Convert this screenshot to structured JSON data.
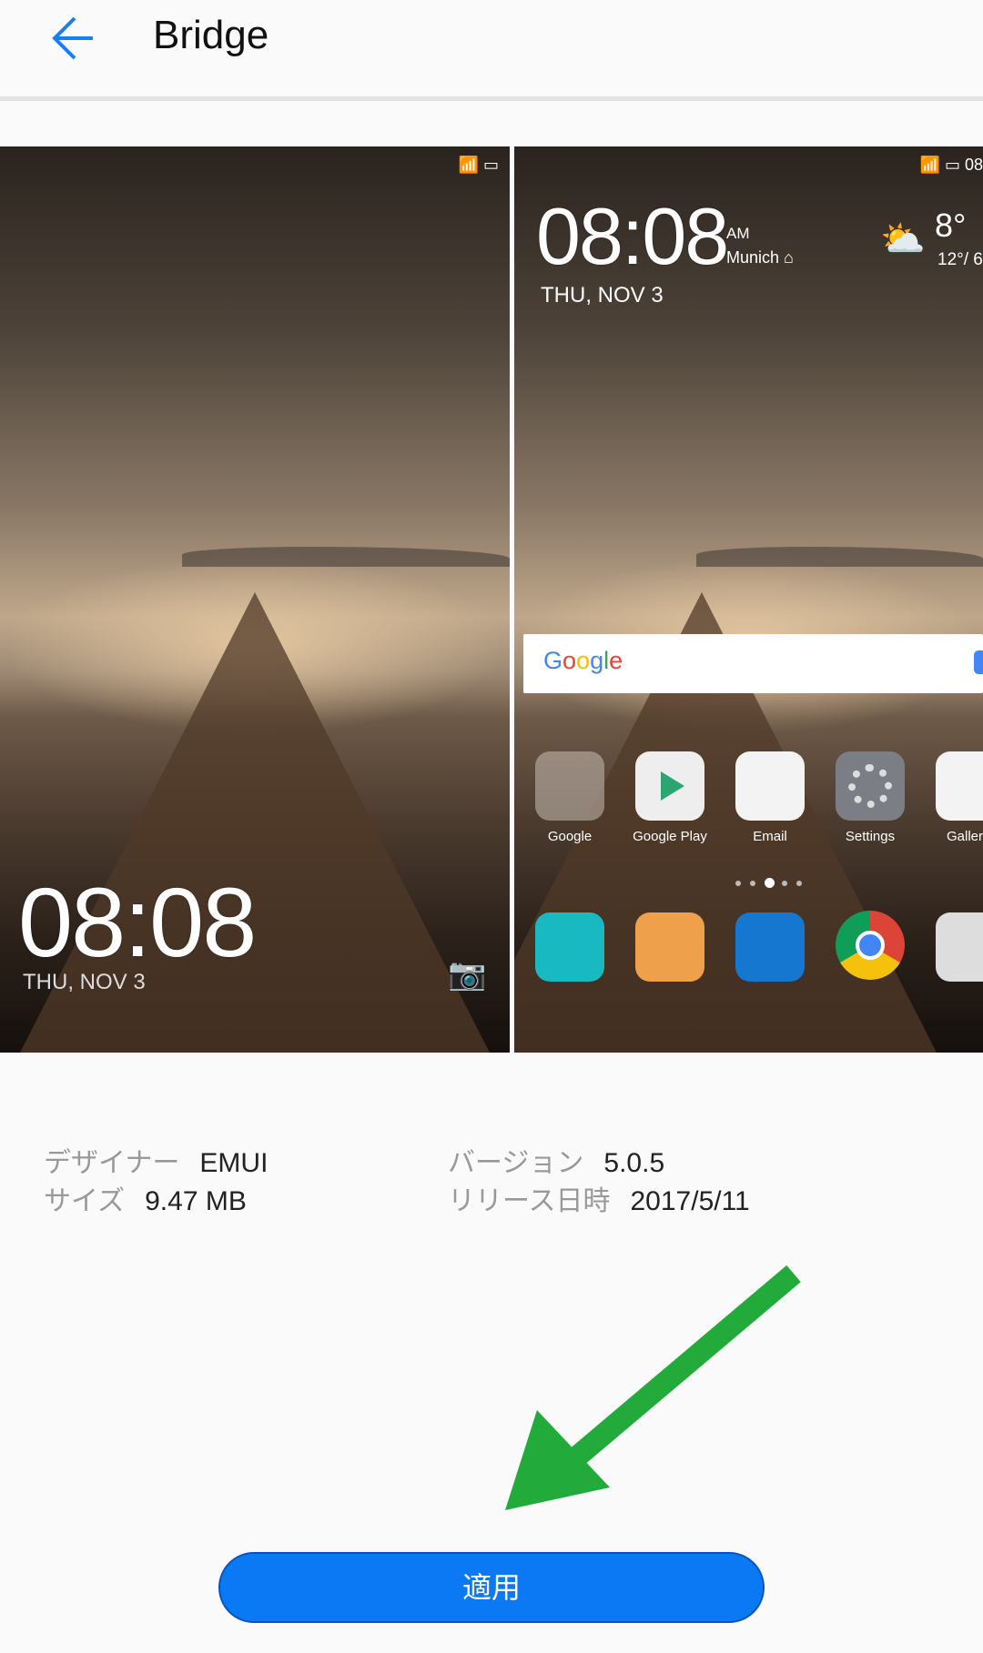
{
  "header": {
    "title": "Bridge",
    "back_icon": "arrow-left-icon"
  },
  "lock_preview": {
    "time": "08:08",
    "date": "THU, NOV 3"
  },
  "home_preview": {
    "time": "08:08",
    "ampm": "AM",
    "city": "Munich",
    "date": "THU, NOV 3",
    "temp": "8°",
    "range": "12°/ 6",
    "status_time": "08",
    "search_logo": "Google",
    "apps": [
      "Google",
      "Google Play",
      "Email",
      "Settings",
      "Galler"
    ]
  },
  "info": {
    "designer_label": "デザイナー",
    "designer": "EMUI",
    "size_label": "サイズ",
    "size": "9.47 MB",
    "version_label": "バージョン",
    "version": "5.0.5",
    "release_label": "リリース日時",
    "release": "2017/5/11"
  },
  "apply_label": "適用",
  "colors": {
    "accent": "#0a79f3",
    "arrow": "#22aa3a"
  }
}
